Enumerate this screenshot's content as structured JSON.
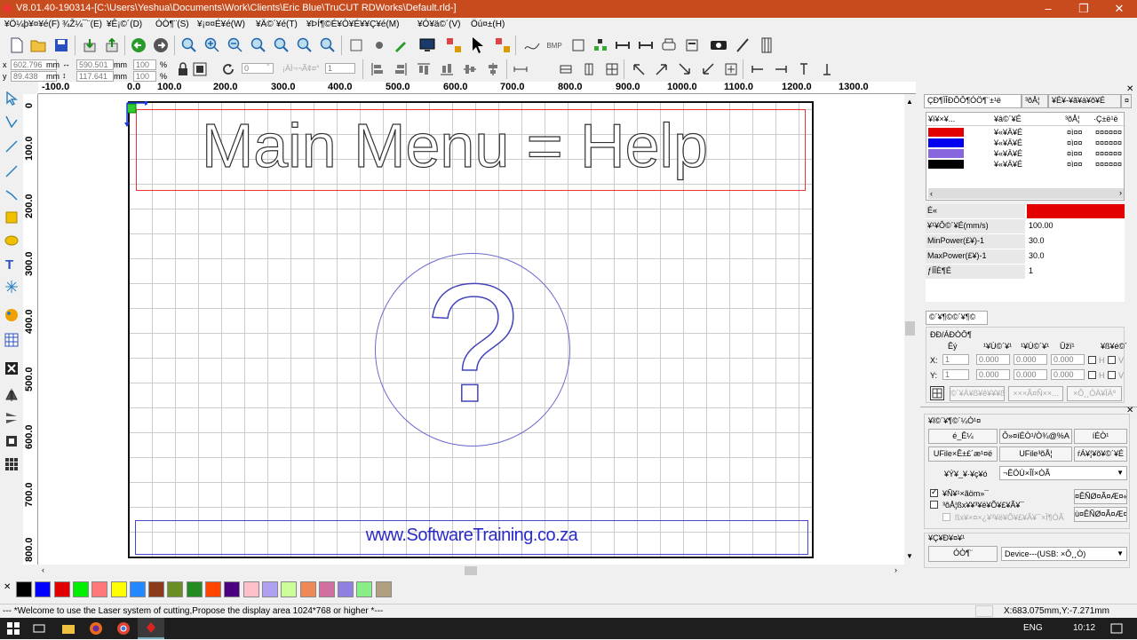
{
  "window": {
    "title": "V8.01.40-190314-[C:\\Users\\Yeshua\\Documents\\Work\\Clients\\Eric Blue\\TruCUT RDWorks\\Default.rld-]"
  },
  "menu": [
    "¥Ö¼þ¥¤¥é(F)",
    "¾Ž¼¯¨(E)",
    "¥Ê¡©´(D)",
    "ÓÒ¶¨(S)",
    "¥¡¤¤É¥é(W)",
    "¥Ä©´¥é(T)",
    "¥ÞÍ¶©É¥Ò¥É¥¥Ç¥é(M)",
    "¥Ó¥ä©´(V)",
    "Öú¤±(H)"
  ],
  "coords": {
    "x_label": "x",
    "y_label": "y",
    "x": "602.796",
    "y": "89.438",
    "unit": "mm",
    "w": "590.501",
    "h": "117.641",
    "sx": "100",
    "sy": "100",
    "pct": "%",
    "rot": "0",
    "rot_unit": "°",
    "num": "1",
    "hint": "¡ÀÌ¬¬Ã¢¤°"
  },
  "ruler": {
    "top": [
      "-100.0",
      "0.0",
      "100.0",
      "200.0",
      "300.0",
      "400.0",
      "500.0",
      "600.0",
      "700.0",
      "800.0",
      "900.0",
      "1000.0",
      "1100.0",
      "1200.0",
      "1300.0"
    ],
    "left": [
      "0",
      "100.0",
      "200.0",
      "300.0",
      "400.0",
      "500.0",
      "600.0",
      "700.0",
      "800.0"
    ]
  },
  "design": {
    "heading": "Main Menu = Help",
    "symbol": "?",
    "footer": "www.SoftwareTraining.co.za"
  },
  "layers": {
    "tabs": [
      "ÇÐ¶ÏÎÐÕÔ¶ÓÖ¶¨±¹ë",
      "³õÅ¦",
      "¥É¥-¥ã¥á¥õ¥É",
      "¤"
    ],
    "headers": [
      "¥ì¥×¥...",
      "¥â©´¥É",
      "³õÅ¦",
      "·Ç±ë¹ë"
    ],
    "rows": [
      {
        "color": "#e30000",
        "mode": "¥«¥Ä¥É",
        "out": "¤ì¤¤",
        "extra": "¤¤¤¤¤¤"
      },
      {
        "color": "#0000ee",
        "mode": "¥«¥Ä¥É",
        "out": "¤ì¤¤",
        "extra": "¤¤¤¤¤¤"
      },
      {
        "color": "#8866dd",
        "mode": "¥«¥Ä¥É",
        "out": "¤ì¤¤",
        "extra": "¤¤¤¤¤¤"
      },
      {
        "color": "#000000",
        "mode": "¥«¥Ä¥É",
        "out": "¤ì¤¤",
        "extra": "¤¤¤¤¤¤"
      }
    ]
  },
  "params": [
    {
      "label": "É«",
      "value": "",
      "swatch": "#e30000"
    },
    {
      "label": "¥¹¥Ô©´¥É(mm/s)",
      "value": "100.00"
    },
    {
      "label": "MinPower(£¥)-1",
      "value": "30.0"
    },
    {
      "label": "MaxPower(£¥)-1",
      "value": "30.0"
    },
    {
      "label": "ƒÍÎÈ¶É",
      "value": "1"
    }
  ],
  "transform": {
    "tab": "©´¥¶©©´¥¶©",
    "section": "ÐÐ/ÁÐÒÔ¶",
    "headers": [
      "Êý",
      "¹¥Ú©´¥¹",
      "¹¥Ú©´¥¹",
      "Ûžï¹",
      "¥ß¥é©´"
    ],
    "x_label": "X:",
    "y_label": "Y:",
    "x": [
      "1",
      "0.000",
      "0.000",
      "0.000"
    ],
    "y": [
      "1",
      "0.000",
      "0.000",
      "0.000"
    ],
    "opt_h": "H",
    "opt_v": "V",
    "bottom": [
      "©´¥Á¥ß¥ê¥¥¥ß",
      "×××Ã¤Ñ××...",
      "×Ô¸¸ÓÀ¥ÏÁº"
    ]
  },
  "device": {
    "title": "¥î©´¥¶©´¼Ó¹¤",
    "buttons": [
      "é_Ê¼",
      "Ô»¤íÉÒ¹/Ò¾@%A",
      "íÉÒ¹",
      "UFile×Ê±£´æ¹¤ë",
      "UFile³õÅ¦",
      "ŕÁ¥¦¥õ¥©´¥É"
    ],
    "select_label": "¥Ý¥_¥·¥ç¥ó",
    "select_value": "¬ÊÖÚ×ÎÏ×ÒÃ",
    "checks": [
      {
        "label": "¥Ñ¥¹×ãöm»¯",
        "checked": true
      },
      {
        "label": "³õÅ¦ßx¥¥³¥ë¥Õ¥£¥Ã¥¯",
        "checked": false
      },
      {
        "label": "ßx¥×¤×¿¥³¥ë¥Õ¥£¥Ã¥¯×Î¶ÒÃ",
        "checked": false
      }
    ],
    "side_buttons": [
      "¤ÊÑØ¤Ã¤Æ¤«",
      "ù¤ÊÑØ¤Ã¤Æ¤ß"
    ]
  },
  "port": {
    "title": "¥Ç¥Ð¥¤¥¹",
    "button": "ÓÒ¶¨",
    "value": "Device---(USB: ×Ô¸¸Ó)"
  },
  "palette": [
    "#000000",
    "#0000ff",
    "#e00000",
    "#00ee00",
    "#ff7777",
    "#ffff00",
    "#2288ff",
    "#8b3a1a",
    "#6b8e23",
    "#228b22",
    "#ff4500",
    "#4b0082",
    "#ffc0cb",
    "#b0a0f0",
    "#ccff99",
    "#ee8855",
    "#d070a0",
    "#9080e0",
    "#88ee88",
    "#b0a080"
  ],
  "status": {
    "message": "--- *Welcome to use the Laser system of cutting,Propose the display area 1024*768 or higher *---",
    "coords": "X:683.075mm,Y:-7.271mm"
  },
  "taskbar": {
    "lang": "ENG",
    "time": "10:12"
  }
}
